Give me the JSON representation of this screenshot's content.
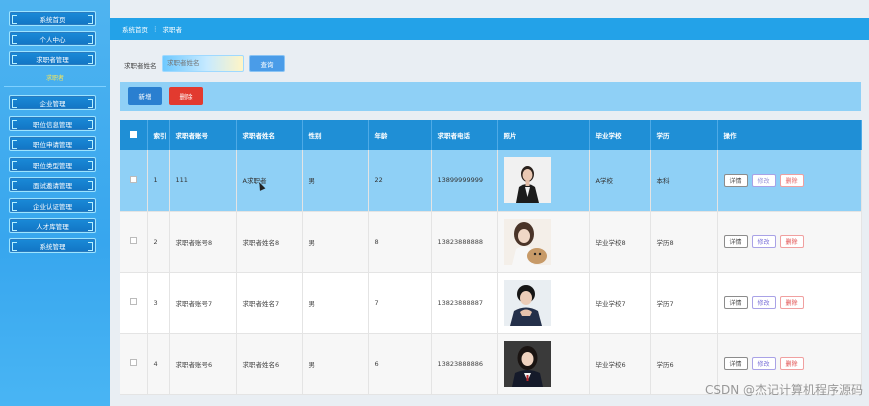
{
  "sidebar": {
    "items": [
      {
        "label": "系统首页"
      },
      {
        "label": "个人中心"
      },
      {
        "label": "求职者管理"
      },
      {
        "label": "企业管理"
      },
      {
        "label": "职位信息管理"
      },
      {
        "label": "职位申请管理"
      },
      {
        "label": "职位类型管理"
      },
      {
        "label": "面试邀请管理"
      },
      {
        "label": "企业认证管理"
      },
      {
        "label": "人才库管理"
      },
      {
        "label": "系统管理"
      }
    ],
    "sub_item": "求职者"
  },
  "breadcrumb": {
    "home": "系统首页",
    "separator": "⋮",
    "current": "求职者"
  },
  "search": {
    "label": "求职者姓名",
    "placeholder": "求职者姓名",
    "button": "查询"
  },
  "actions": {
    "add": "新增",
    "delete": "删除"
  },
  "table": {
    "headers": [
      "",
      "索引",
      "求职者账号",
      "求职者姓名",
      "性别",
      "年龄",
      "求职者电话",
      "照片",
      "毕业学校",
      "学历",
      "操作"
    ],
    "row_actions": {
      "detail": "详情",
      "edit": "修改",
      "remove": "删除"
    },
    "rows": [
      {
        "index": "1",
        "account": "111",
        "name": "A求职者",
        "gender": "男",
        "age": "22",
        "phone": "13899999999",
        "school": "A学校",
        "degree": "本科"
      },
      {
        "index": "2",
        "account": "求职者账号8",
        "name": "求职者姓名8",
        "gender": "男",
        "age": "8",
        "phone": "13823888888",
        "school": "毕业学校8",
        "degree": "学历8"
      },
      {
        "index": "3",
        "account": "求职者账号7",
        "name": "求职者姓名7",
        "gender": "男",
        "age": "7",
        "phone": "13823888887",
        "school": "毕业学校7",
        "degree": "学历7"
      },
      {
        "index": "4",
        "account": "求职者账号6",
        "name": "求职者姓名6",
        "gender": "男",
        "age": "6",
        "phone": "13823888886",
        "school": "毕业学校6",
        "degree": "学历6"
      }
    ]
  },
  "watermark": "CSDN @杰记计算机程序源码"
}
